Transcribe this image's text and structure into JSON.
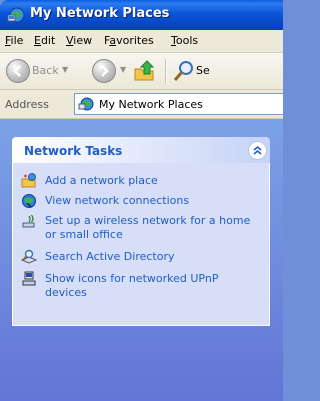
{
  "window": {
    "title": "My Network Places",
    "title_icon": "network-places-icon"
  },
  "menu": {
    "items": [
      {
        "label": "File",
        "mnemonic": "F"
      },
      {
        "label": "Edit",
        "mnemonic": "E"
      },
      {
        "label": "View",
        "mnemonic": "V"
      },
      {
        "label": "Favorites",
        "mnemonic": "a"
      },
      {
        "label": "Tools",
        "mnemonic": "T"
      }
    ]
  },
  "toolbar": {
    "back_label": "Back",
    "search_label_partial": "Se"
  },
  "address": {
    "label": "Address",
    "value": "My Network Places"
  },
  "taskpane": {
    "group_title": "Network Tasks",
    "tasks": [
      {
        "label": "Add a network place",
        "icon": "add-network-place-icon"
      },
      {
        "label": "View network connections",
        "icon": "network-connections-icon"
      },
      {
        "label": "Set up a wireless network for a home or small office",
        "icon": "wireless-network-icon"
      },
      {
        "label": "Search Active Directory",
        "icon": "search-directory-icon"
      },
      {
        "label": "Show icons for networked UPnP devices",
        "icon": "upnp-devices-icon"
      }
    ]
  },
  "colors": {
    "titlebar": "#0b55d9",
    "task_link": "#215dc6",
    "pane_background": "#6f8fd8"
  }
}
